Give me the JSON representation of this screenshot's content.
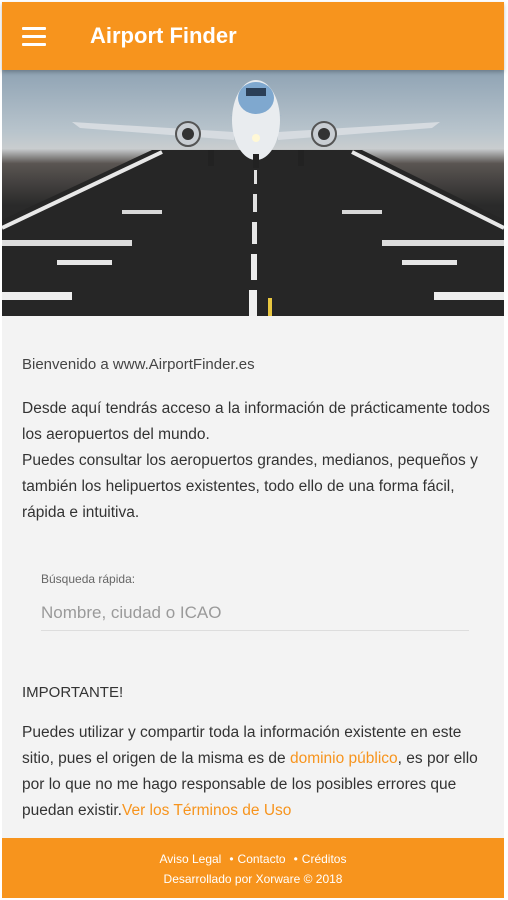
{
  "app": {
    "title": "Airport Finder",
    "menu_icon": "hamburger-menu-icon",
    "accent": "#F7941D"
  },
  "welcome": "Bienvenido a www.AirportFinder.es",
  "intro": {
    "line1": "Desde aquí tendrás acceso a la información de prácticamente todos los aeropuertos del mundo.",
    "line2": "Puedes consultar los aeropuertos grandes, medianos, pequeños y también los helipuertos existentes, todo ello de una forma fácil, rápida e intuitiva."
  },
  "search": {
    "label": "Búsqueda rápida:",
    "placeholder": "Nombre, ciudad o ICAO",
    "value": ""
  },
  "important": {
    "title": "IMPORTANTE!",
    "text_before": "Puedes utilizar y compartir toda la información existente en este sitio, pues el origen de la misma es de ",
    "link1": "dominio público",
    "text_middle": ", es por ello por lo que no me hago responsable de los posibles errores que puedan existir.",
    "link2": "Ver los Términos de Uso"
  },
  "footer": {
    "links": [
      "Aviso Legal",
      "Contacto",
      "Créditos"
    ],
    "separator": "•",
    "credits": "Desarrollado por Xorware © 2018"
  }
}
